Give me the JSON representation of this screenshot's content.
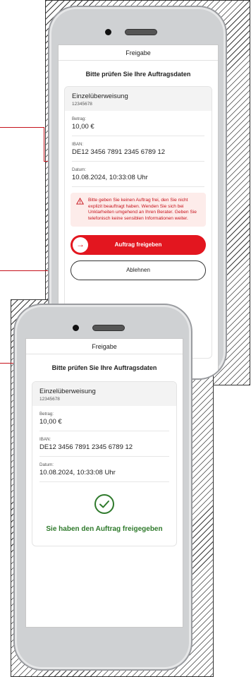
{
  "phone1": {
    "title": "Freigabe",
    "heading": "Bitte prüfen Sie Ihre Auftragsdaten",
    "transfer_type": "Einzelüberweisung",
    "account_number": "12345678",
    "fields": [
      {
        "label": "Betrag:",
        "value": "10,00 €"
      },
      {
        "label": "IBAN:",
        "value": "DE12 3456 7891 2345 6789 12"
      },
      {
        "label": "Datum:",
        "value": "10.08.2024, 10:33:08 Uhr"
      }
    ],
    "warning": "Bitte geben Sie keinen Auftrag frei, den Sie nicht explizit beauftragt haben. Wenden Sie sich bei Unklarheiten umgehend an Ihren Berater. Geben Sie telefonisch keine sensiblen Informationen weiter.",
    "approve_label": "Auftrag freigeben",
    "approve_arrow": "→",
    "reject_label": "Ablehnen"
  },
  "phone2": {
    "title": "Freigabe",
    "heading": "Bitte prüfen Sie Ihre Auftragsdaten",
    "transfer_type": "Einzelüberweisung",
    "account_number": "12345678",
    "fields": [
      {
        "label": "Betrag:",
        "value": "10,00 €"
      },
      {
        "label": "IBAN:",
        "value": "DE12 3456 7891 2345 6789 12"
      },
      {
        "label": "Datum:",
        "value": "10.08.2024, 10:33:08 Uhr"
      }
    ],
    "success_message": "Sie haben den Auftrag freigegeben"
  },
  "colors": {
    "accent_red": "#e3161f",
    "warning_bg": "#fdecea",
    "success_green": "#2f7a2c"
  },
  "icons": {
    "warning": "warning-triangle-icon",
    "arrow": "arrow-right-icon",
    "success": "check-circle-icon"
  }
}
